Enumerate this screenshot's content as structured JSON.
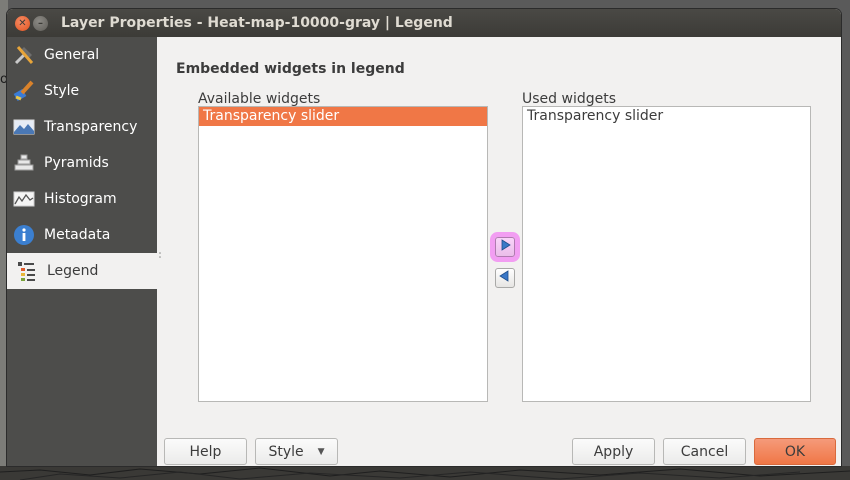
{
  "window": {
    "title": "Layer Properties - Heat-map-10000-gray | Legend"
  },
  "sidebar": {
    "items": [
      {
        "label": "General",
        "icon": "tools-icon"
      },
      {
        "label": "Style",
        "icon": "brush-icon"
      },
      {
        "label": "Transparency",
        "icon": "transparency-icon"
      },
      {
        "label": "Pyramids",
        "icon": "pyramids-icon"
      },
      {
        "label": "Histogram",
        "icon": "histogram-icon"
      },
      {
        "label": "Metadata",
        "icon": "info-icon"
      },
      {
        "label": "Legend",
        "icon": "legend-icon",
        "active": true
      }
    ]
  },
  "legend": {
    "group_title": "Embedded widgets in legend",
    "available_label": "Available widgets",
    "used_label": "Used widgets",
    "available_items": [
      "Transparency slider"
    ],
    "used_items": [
      "Transparency slider"
    ]
  },
  "buttons": {
    "help": "Help",
    "style": "Style",
    "apply": "Apply",
    "cancel": "Cancel",
    "ok": "OK"
  },
  "colors": {
    "selection": "#f07746",
    "sidebar": "#4d4d4b",
    "highlight": "#f29ef2"
  }
}
